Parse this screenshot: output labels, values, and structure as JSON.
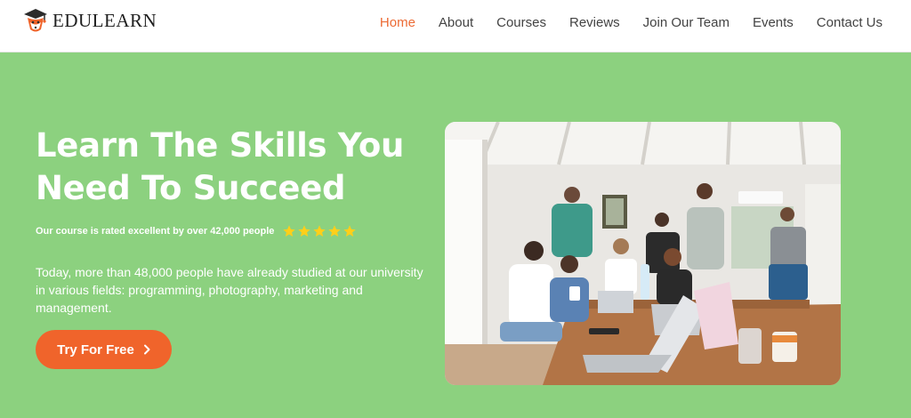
{
  "brand": {
    "name": "EDULEARN",
    "logo_icon": "graduation-cap-fox-icon"
  },
  "nav": {
    "items": [
      {
        "label": "Home",
        "active": true
      },
      {
        "label": "About",
        "active": false
      },
      {
        "label": "Courses",
        "active": false
      },
      {
        "label": "Reviews",
        "active": false
      },
      {
        "label": "Join Our Team",
        "active": false
      },
      {
        "label": "Events",
        "active": false
      },
      {
        "label": "Contact Us",
        "active": false
      }
    ]
  },
  "hero": {
    "title": "Learn The Skills You Need To Succeed",
    "rating_text": "Our course is rated excellent by over 42,000 people",
    "rating_stars": 5,
    "description": "Today, more than 48,000 people have already studied at our university in various fields: programming, photography, marketing and management.",
    "cta_label": "Try For Free",
    "cta_icon": "chevron-right-icon"
  },
  "colors": {
    "hero_background": "#8cd17f",
    "accent": "#f0642b",
    "nav_active": "#ec6b35",
    "star": "#ffcf1a"
  }
}
